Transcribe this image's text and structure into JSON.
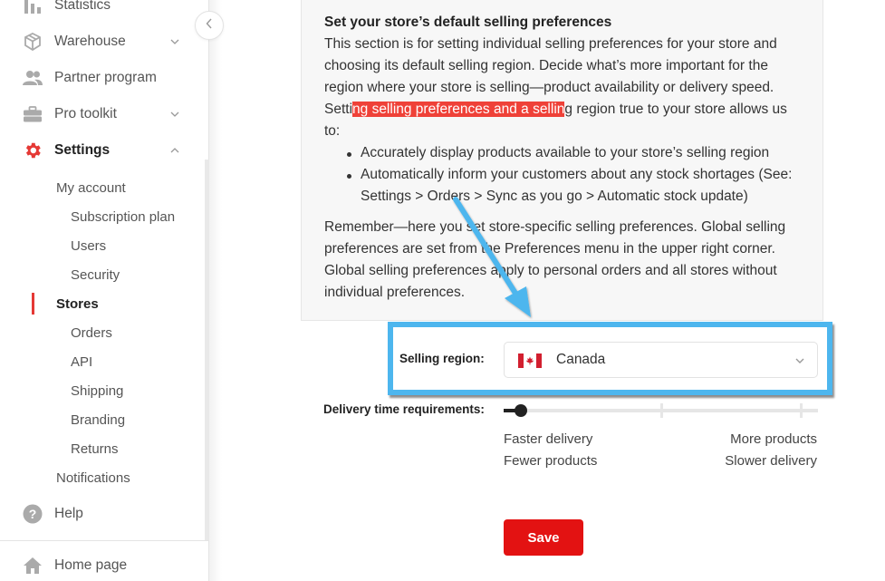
{
  "sidebar": {
    "items": [
      {
        "label": "Statistics",
        "icon": "bar-chart-icon"
      },
      {
        "label": "Warehouse",
        "icon": "box-icon",
        "expandable": true
      },
      {
        "label": "Partner program",
        "icon": "people-icon"
      },
      {
        "label": "Pro toolkit",
        "icon": "briefcase-icon",
        "expandable": true
      },
      {
        "label": "Settings",
        "icon": "gear-icon",
        "expanded": true,
        "active": true
      }
    ],
    "settings_children": [
      {
        "label": "My account",
        "level": 1
      },
      {
        "label": "Subscription plan",
        "level": 2
      },
      {
        "label": "Users",
        "level": 2
      },
      {
        "label": "Security",
        "level": 2
      },
      {
        "label": "Stores",
        "level": 1,
        "active": true
      },
      {
        "label": "Orders",
        "level": 2
      },
      {
        "label": "API",
        "level": 2
      },
      {
        "label": "Shipping",
        "level": 2
      },
      {
        "label": "Branding",
        "level": 2
      },
      {
        "label": "Returns",
        "level": 2
      },
      {
        "label": "Notifications",
        "level": 1
      }
    ],
    "help": {
      "label": "Help",
      "icon": "help-icon"
    },
    "home": {
      "label": "Home page",
      "icon": "home-icon"
    },
    "collapse_icon": "chevron-left-icon"
  },
  "info": {
    "title": "Set your store’s default selling preferences",
    "lines": [
      "This section is for setting individual selling preferences for your store and",
      "choosing its default selling region. Decide what’s more important for the",
      "region where your store is selling—product availability or delivery speed."
    ],
    "line4_before": "Setti",
    "line4_highlight": "ng selling preferences and a sellin",
    "line4_after": "g region true to your store allows us",
    "line5": "to:",
    "bullets": [
      "Accurately display products available to your store’s selling region",
      "Automatically inform your customers about any stock shortages (See:"
    ],
    "bullet2_cont": "Settings > Orders > Sync as you go > Automatic stock update)",
    "remember_lines": [
      "Remember—here you set store-specific selling preferences. Global selling",
      "preferences are set from the Preferences menu in the upper right corner.",
      "Global selling preferences apply to personal orders and all stores without",
      "individual preferences."
    ]
  },
  "region": {
    "label": "Selling region:",
    "value": "Canada",
    "flag_icon": "canada-flag-icon"
  },
  "delivery": {
    "label": "Delivery time requirements:",
    "slider_value_fraction": 0.055,
    "slider_ticks": 3,
    "left_top": "Faster delivery",
    "left_bottom": "Fewer products",
    "right_top": "More products",
    "right_bottom": "Slower delivery"
  },
  "save_label": "Save",
  "colors": {
    "accent": "#e53935",
    "save": "#e31212",
    "highlight": "#ef4138",
    "annotation": "#4db6ee"
  }
}
